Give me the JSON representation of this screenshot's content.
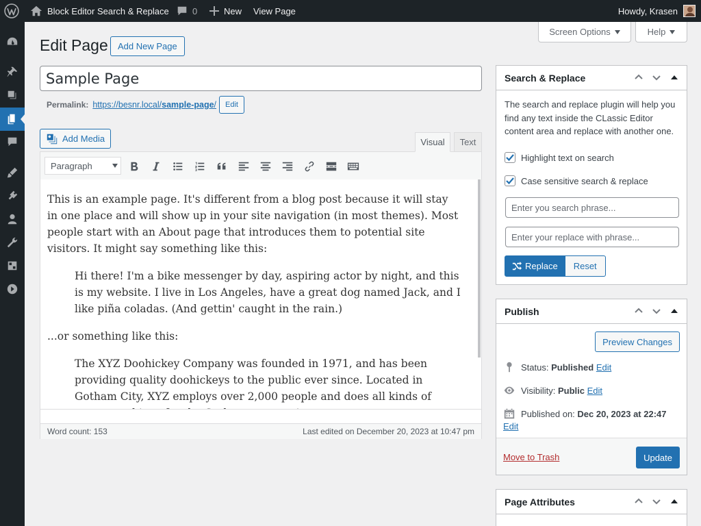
{
  "adminbar": {
    "site_name": "Block Editor Search & Replace",
    "comments_count": "0",
    "new_label": "New",
    "view_page_label": "View Page",
    "howdy": "Howdy, Krasen"
  },
  "screen_meta": {
    "screen_options_label": "Screen Options",
    "help_label": "Help"
  },
  "page": {
    "heading": "Edit Page",
    "add_new_label": "Add New Page",
    "title_value": "Sample Page",
    "permalink_label": "Permalink:",
    "permalink_base": "https://besnr.local/",
    "permalink_slug": "sample-page",
    "permalink_trailing": "/",
    "permalink_edit_label": "Edit"
  },
  "editor": {
    "add_media_label": "Add Media",
    "tab_visual": "Visual",
    "tab_text": "Text",
    "format_select_value": "Paragraph",
    "toolbar_buttons": [
      "bold-icon",
      "italic-icon",
      "bulleted-list-icon",
      "numbered-list-icon",
      "blockquote-icon",
      "align-left-icon",
      "align-center-icon",
      "align-right-icon",
      "insert-link-icon",
      "read-more-icon",
      "toolbar-toggle-icon"
    ],
    "content": {
      "p1": "This is an example page. It's different from a blog post because it will stay in one place and will show up in your site navigation (in most themes). Most people start with an About page that introduces them to potential site visitors. It might say something like this:",
      "quote1": "Hi there! I'm a bike messenger by day, aspiring actor by night, and this is my website. I live in Los Angeles, have a great dog named Jack, and I like piña coladas. (And gettin' caught in the rain.)",
      "p2": "...or something like this:",
      "quote2": "The XYZ Doohickey Company was founded in 1971, and has been providing quality doohickeys to the public ever since. Located in Gotham City, XYZ employs over 2,000 people and does all kinds of awesome things for the Gotham community."
    },
    "word_count": "Word count: 153",
    "last_edited": "Last edited on December 20, 2023 at 10:47 pm"
  },
  "search_replace": {
    "title": "Search & Replace",
    "description": "The search and replace plugin will help you find any text inside the CLassic Editor content area and replace with another one.",
    "highlight_label": "Highlight text on search",
    "highlight_checked": true,
    "case_sensitive_label": "Case sensitive search & replace",
    "case_sensitive_checked": true,
    "search_placeholder": "Enter you search phrase...",
    "replace_placeholder": "Enter your replace with phrase...",
    "replace_label": "Replace",
    "reset_label": "Reset"
  },
  "publish": {
    "title": "Publish",
    "preview_label": "Preview Changes",
    "status_label": "Status:",
    "status_value": "Published",
    "visibility_label": "Visibility:",
    "visibility_value": "Public",
    "published_on_label": "Published on:",
    "published_on_value": "Dec 20, 2023 at 22:47",
    "edit_label": "Edit",
    "trash_label": "Move to Trash",
    "update_label": "Update"
  },
  "page_attributes": {
    "title": "Page Attributes"
  },
  "colors": {
    "adminbar_bg": "#1d2327",
    "accent": "#2271b1",
    "danger": "#b32d2e"
  }
}
